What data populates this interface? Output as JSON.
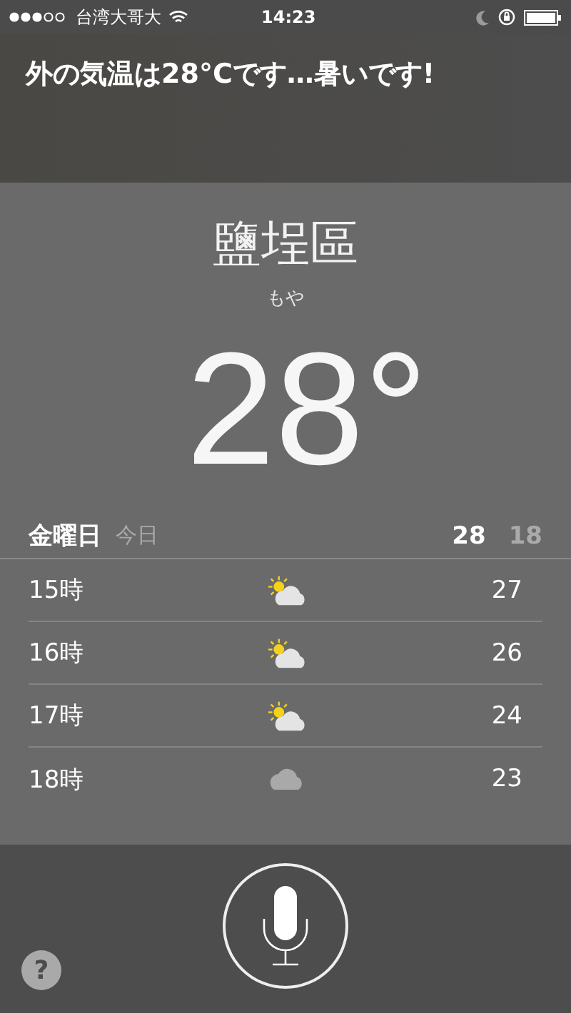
{
  "status_bar": {
    "carrier": "台湾大哥大",
    "time": "14:23"
  },
  "siri_response": "外の気温は28°Cです…暑いです!",
  "weather": {
    "city": "鹽埕區",
    "condition": "もや",
    "temperature": "28°",
    "today": {
      "day": "金曜日",
      "label": "今日",
      "high": "28",
      "low": "18"
    },
    "hours": [
      {
        "time": "15時",
        "kind": "partly_cloudy",
        "temp": "27"
      },
      {
        "time": "16時",
        "kind": "partly_cloudy",
        "temp": "26"
      },
      {
        "time": "17時",
        "kind": "partly_cloudy",
        "temp": "24"
      },
      {
        "time": "18時",
        "kind": "cloudy",
        "temp": "23"
      }
    ]
  },
  "help_button": "?"
}
